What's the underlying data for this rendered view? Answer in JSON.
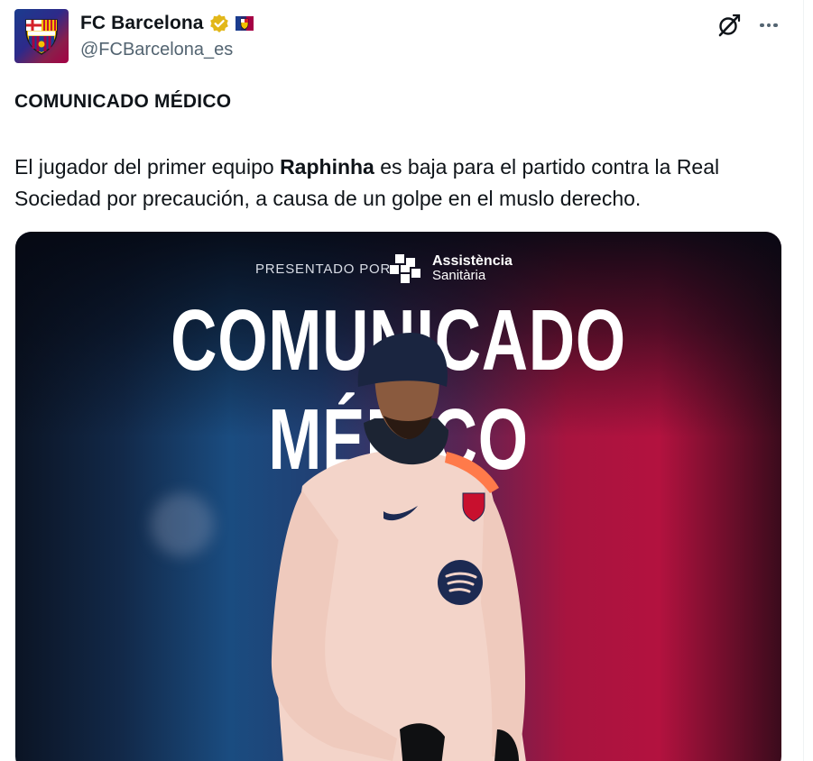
{
  "author": {
    "display_name": "FC Barcelona",
    "handle": "@FCBarcelona_es",
    "verified_color": "#e2b719",
    "avatar_colors": [
      "#1b3c8e",
      "#a50044"
    ]
  },
  "actions": {
    "grok_icon": "grok-slash-icon",
    "more_icon": "more-dots-icon"
  },
  "post": {
    "title": "COMUNICADO MÉDICO",
    "body_prefix": "El jugador del primer equipo ",
    "body_bold": "Raphinha",
    "body_suffix": " es baja para el partido contra la Real Sociedad por precaución, a causa de un golpe en el muslo derecho."
  },
  "media": {
    "presented_by": "PRESENTADO POR",
    "sponsor_name": "Assistència",
    "sponsor_sub": "Sanitària",
    "headline": "COMUNICADO MÉDICO"
  }
}
